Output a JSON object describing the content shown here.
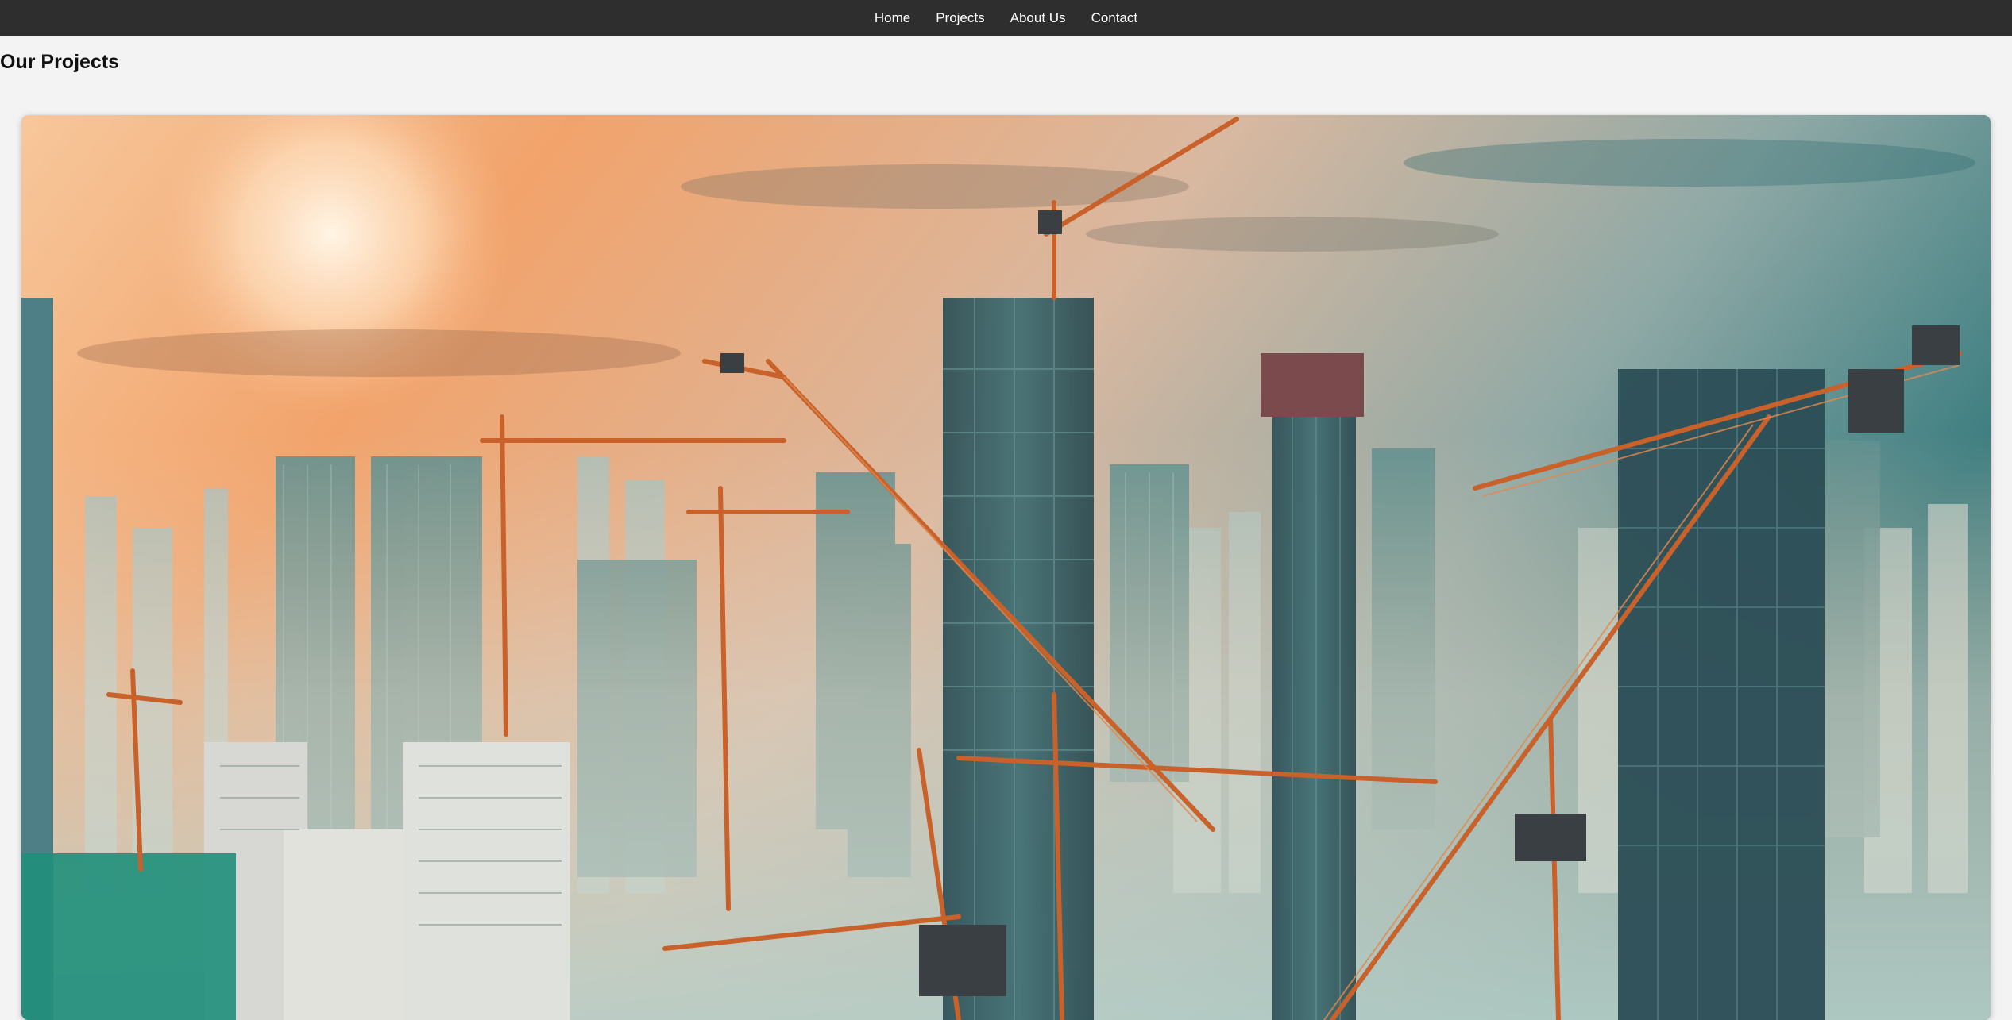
{
  "nav": {
    "links": [
      {
        "label": "Home"
      },
      {
        "label": "Projects"
      },
      {
        "label": "About Us"
      },
      {
        "label": "Contact"
      }
    ]
  },
  "main": {
    "title": "Our Projects"
  },
  "colors": {
    "nav_bg": "#2e2e2e",
    "page_bg": "#f3f3f3",
    "sky_warm": "#f3a66a",
    "sky_teal": "#3f7f82",
    "crane_orange": "#c8612a",
    "tower_teal": "#2f5a5f"
  }
}
